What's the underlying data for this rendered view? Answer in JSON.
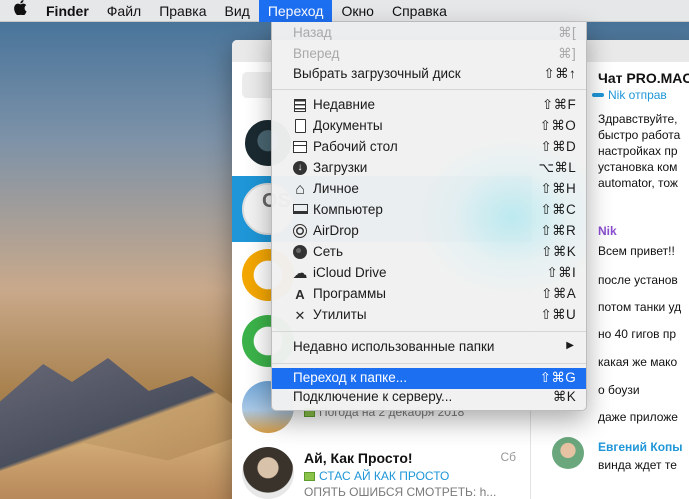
{
  "menubar": {
    "apple_icon": "apple-icon",
    "items": [
      "Finder",
      "Файл",
      "Правка",
      "Вид",
      "Переход",
      "Окно",
      "Справка"
    ],
    "active": "Переход"
  },
  "go_menu": {
    "items": [
      {
        "label": "Назад",
        "shortcut": "⌘[",
        "enabled": false
      },
      {
        "label": "Вперед",
        "shortcut": "⌘]",
        "enabled": false
      },
      {
        "label": "Выбрать загрузочный диск",
        "shortcut": "⇧⌘↑",
        "enabled": true
      },
      {
        "label": "Недавние",
        "shortcut": "⇧⌘F",
        "icon": "recents-icon",
        "glyph": ""
      },
      {
        "label": "Документы",
        "shortcut": "⇧⌘O",
        "icon": "documents-icon",
        "glyph": ""
      },
      {
        "label": "Рабочий стол",
        "shortcut": "⇧⌘D",
        "icon": "desktop-icon",
        "glyph": ""
      },
      {
        "label": "Загрузки",
        "shortcut": "⌥⌘L",
        "icon": "downloads-icon",
        "glyph": "↓"
      },
      {
        "label": "Личное",
        "shortcut": "⇧⌘H",
        "icon": "home-icon",
        "glyph": "⌂"
      },
      {
        "label": "Компьютер",
        "shortcut": "⇧⌘C",
        "icon": "computer-icon",
        "glyph": ""
      },
      {
        "label": "AirDrop",
        "shortcut": "⇧⌘R",
        "icon": "airdrop-icon",
        "glyph": ""
      },
      {
        "label": "Сеть",
        "shortcut": "⇧⌘K",
        "icon": "network-icon",
        "glyph": ""
      },
      {
        "label": "iCloud Drive",
        "shortcut": "⇧⌘I",
        "icon": "icloud-icon",
        "glyph": "☁"
      },
      {
        "label": "Программы",
        "shortcut": "⇧⌘A",
        "icon": "applications-icon",
        "glyph": "A"
      },
      {
        "label": "Утилиты",
        "shortcut": "⇧⌘U",
        "icon": "utilities-icon",
        "glyph": "✕"
      }
    ],
    "recent_folders": {
      "label": "Недавно использованные папки",
      "submenu_icon": "chevron-right-icon"
    },
    "go_to_folder": {
      "label": "Переход к папке...",
      "shortcut": "⇧⌘G",
      "highlighted": true
    },
    "connect_server": {
      "label": "Подключение к серверу...",
      "shortcut": "⌘K"
    }
  },
  "chat_list": {
    "rows": [
      {
        "avatar": "dark-logo-avatar",
        "name": "",
        "snippet": "",
        "time": ""
      },
      {
        "avatar": "macos-avatar",
        "avatar_text": "OS",
        "name": "",
        "snippet": "",
        "time": "",
        "selected": true
      },
      {
        "avatar": "orange-ring-avatar",
        "name": "",
        "snippet": "",
        "time": ""
      },
      {
        "avatar": "green-ring-avatar",
        "name": "",
        "snippet": "",
        "time": ""
      },
      {
        "avatar": "sky-avatar",
        "name": "",
        "snippet": "Погода на 2 декабря 2018",
        "time": ""
      },
      {
        "avatar": "photo-avatar",
        "name": "Ай, Как Просто!",
        "snippet_prefix": "СТАС АЙ КАК ПРОСТО",
        "snippet": "ОПЯТЬ ОШИБСЯ СМОТРЕТЬ: h...",
        "time": "Сб"
      }
    ]
  },
  "conversation": {
    "title": "Чат PRO.MAC",
    "subtitle": "Nik отправ",
    "lines_top": [
      "Здравствуйте,",
      "быстро работа",
      "настройках пр",
      "установка ком",
      "automator, тож"
    ],
    "sender_nik": "Nik",
    "nik_messages": [
      "Всем привет!!",
      "после установ",
      "потом танки уд",
      "но 40 гигов пр",
      "какая же мако",
      "о боузи",
      "даже приложе"
    ],
    "sender_evgeniy": "Евгений Копы",
    "evgeniy_message": "винда ждет те"
  },
  "colors": {
    "accent": "#1d6ff2",
    "telegram_blue": "#1e96d7",
    "nik_color": "#8a4ed0"
  }
}
